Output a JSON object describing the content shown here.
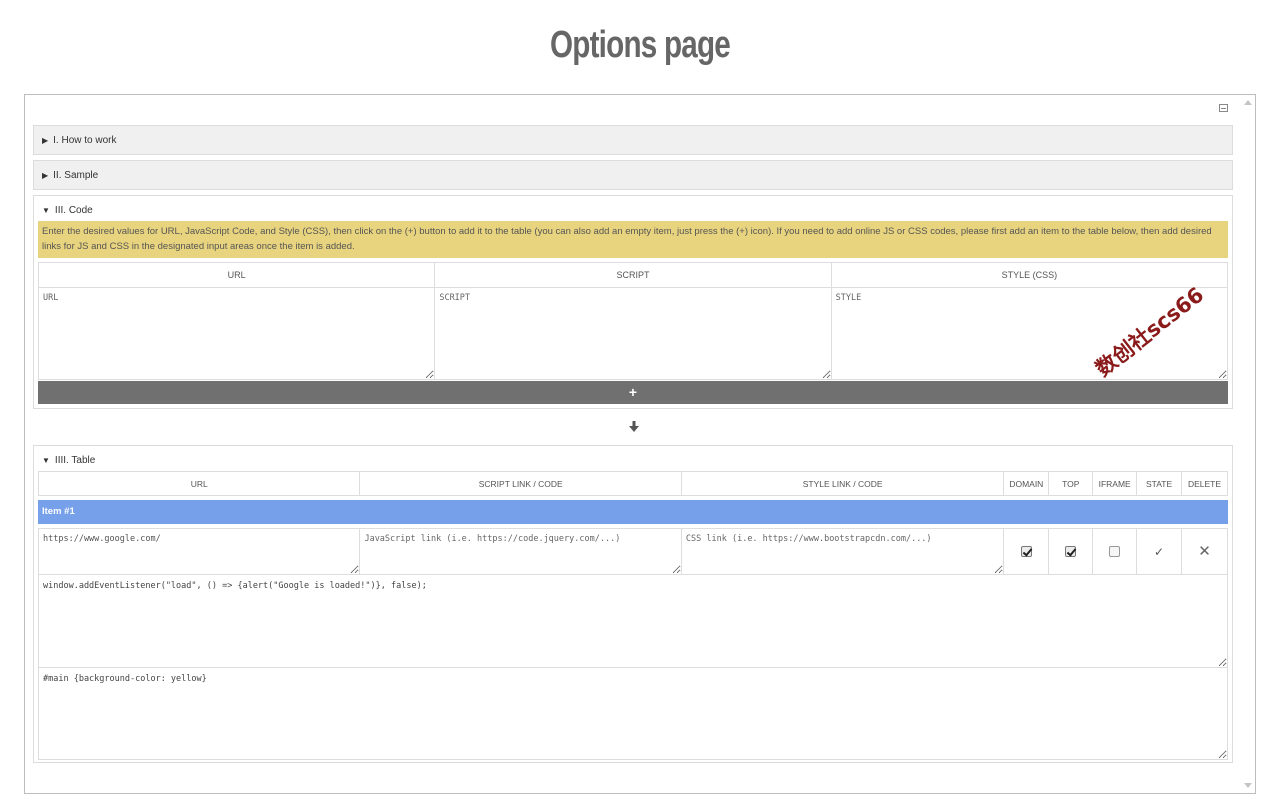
{
  "page": {
    "title": "Options page"
  },
  "sections": {
    "how_to_work": {
      "label": "I. How to work",
      "state": "collapsed"
    },
    "sample": {
      "label": "II. Sample",
      "state": "collapsed"
    },
    "code": {
      "label": "III. Code",
      "state": "expanded",
      "notice": "Enter the desired values for URL, JavaScript Code, and Style (CSS), then click on the (+) button to add it to the table (you can also add an empty item, just press the (+) icon). If you need to add online JS or CSS codes, please first add an item to the table below, then add desired links for JS and CSS in the designated input areas once the item is added.",
      "headers": {
        "url": "URL",
        "script": "SCRIPT",
        "style": "STYLE (CSS)"
      },
      "placeholders": {
        "url": "URL",
        "script": "SCRIPT",
        "style": "STYLE"
      },
      "add_label": "+"
    },
    "table": {
      "label": "IIII. Table",
      "state": "expanded",
      "headers": {
        "url": "URL",
        "script": "SCRIPT LINK / CODE",
        "style": "STYLE LINK / CODE",
        "domain": "DOMAIN",
        "top": "TOP",
        "iframe": "IFRAME",
        "state": "STATE",
        "delete": "DELETE"
      },
      "items": [
        {
          "title": "Item #1",
          "url": "https://www.google.com/",
          "script_link_placeholder": "JavaScript link (i.e. https://code.jquery.com/...)",
          "style_link_placeholder": "CSS link (i.e. https://www.bootstrapcdn.com/...)",
          "domain": true,
          "top": true,
          "iframe": false,
          "state_glyph": "✓",
          "delete_glyph": "✕",
          "script_code": "window.addEventListener(\"load\", () => {alert(\"Google is loaded!\")}, false);",
          "style_code": "#main {background-color: yellow}"
        }
      ]
    }
  },
  "arrow_glyph": "🡇",
  "triangles": {
    "collapsed": "▶",
    "expanded": "▼"
  },
  "watermark": "数创社scs66",
  "icons": [
    "collapse-all-icon",
    "arrow-down-icon",
    "checkmark-icon",
    "close-icon",
    "scroll-up-icon",
    "scroll-down-icon"
  ]
}
